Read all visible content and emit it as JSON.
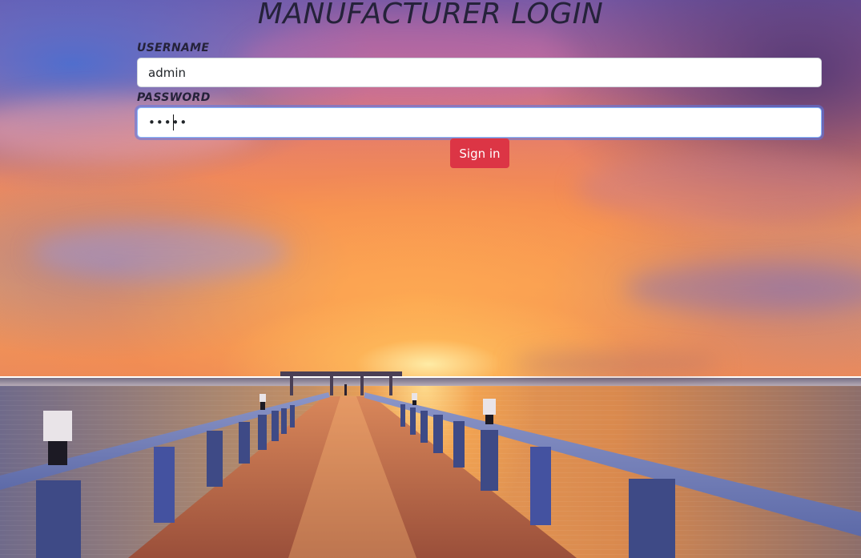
{
  "page": {
    "title": "MANUFACTURER LOGIN"
  },
  "form": {
    "username_label": "USERNAME",
    "username_value": "admin",
    "password_label": "PASSWORD",
    "password_value": "admin",
    "password_masked": true,
    "signin_label": "Sign in"
  },
  "colors": {
    "title_text": "#25223a",
    "button_bg": "#dc3545",
    "button_text": "#ffffff",
    "focus_ring": "#5a78e6"
  },
  "background": {
    "scene": "sunset-pier-photo"
  }
}
